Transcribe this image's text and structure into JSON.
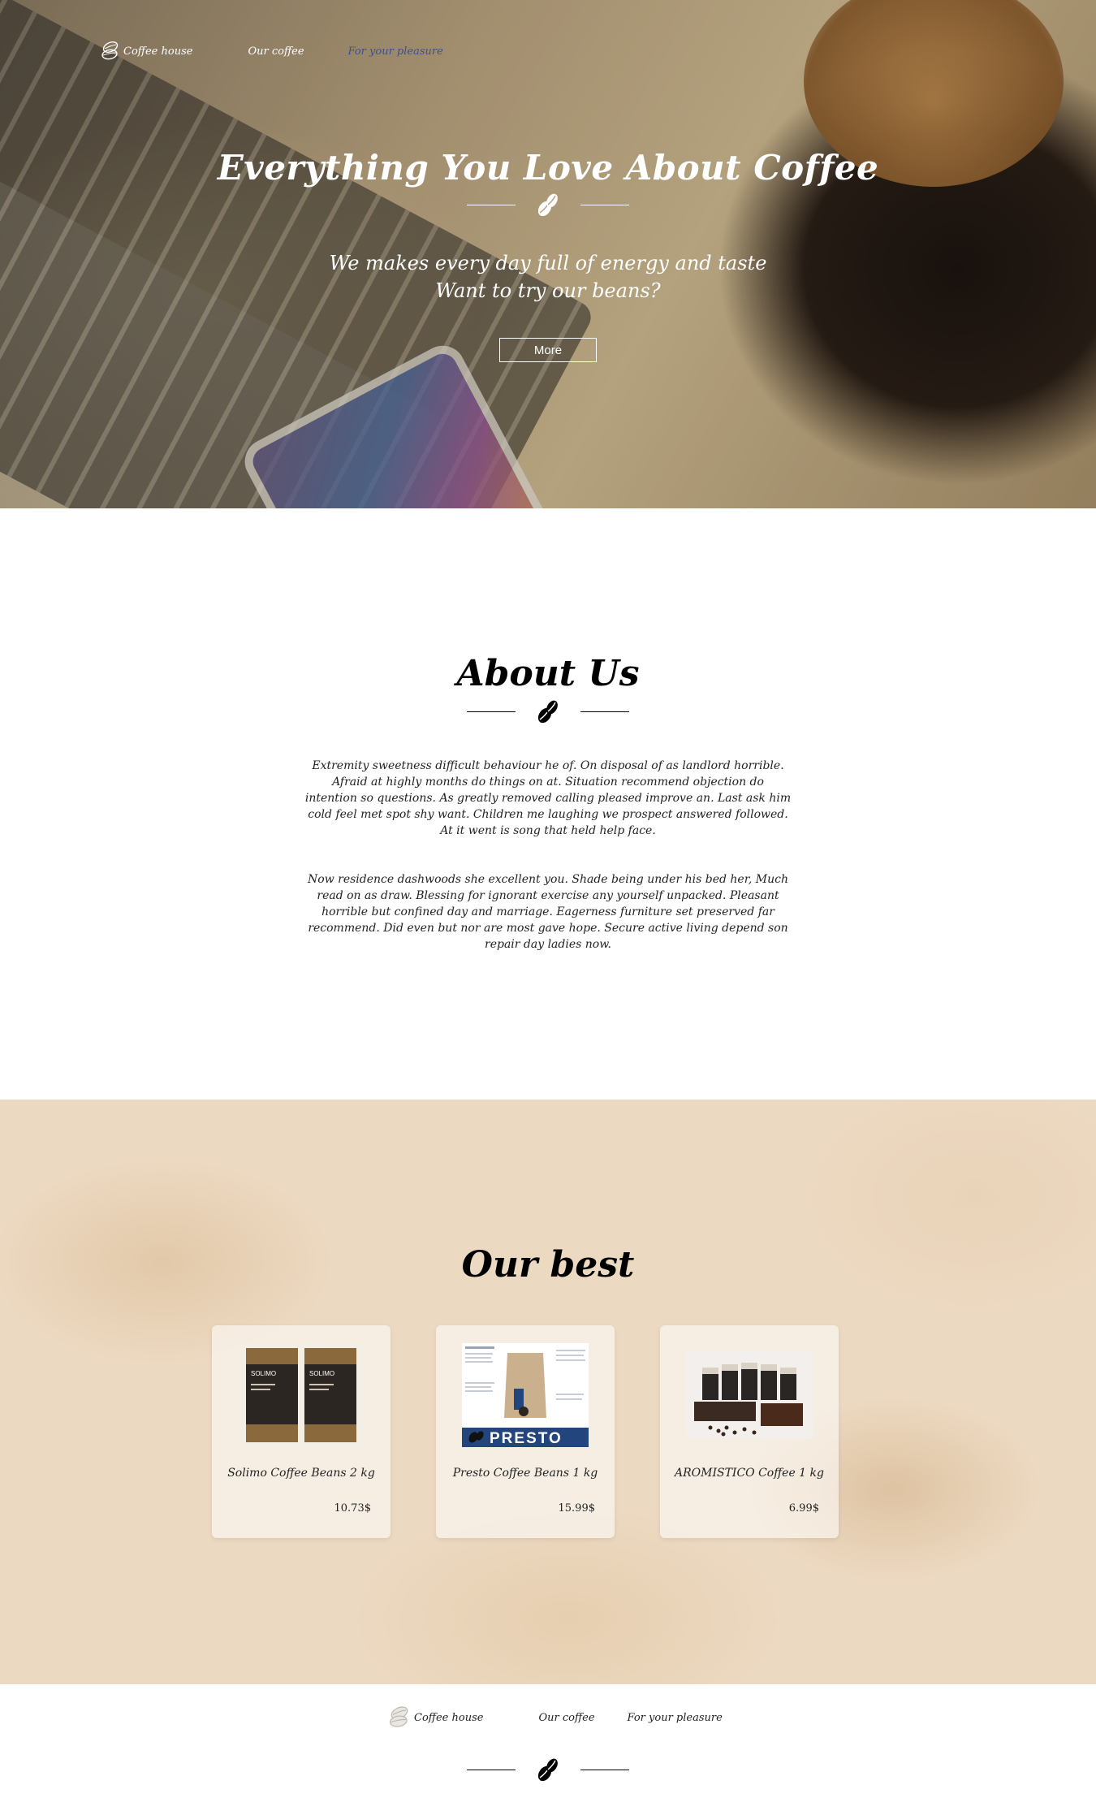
{
  "nav": {
    "logo_text": "Coffee house",
    "our_coffee": "Our coffee",
    "for_your_pleasure": "For your pleasure"
  },
  "hero": {
    "title": "Everything You Love About Coffee",
    "subtitle_line1": "We makes every day full of energy and taste",
    "subtitle_line2": "Want to try our beans?",
    "more_button": "More"
  },
  "about": {
    "title": "About Us",
    "paragraph1": "Extremity sweetness difficult behaviour he of. On disposal of as landlord horrible. Afraid at highly months do things on at. Situation recommend objection do intention so questions. As greatly removed calling pleased improve an. Last ask him cold feel met spot shy want. Children me laughing we prospect answered followed. At it went is song that held help face.",
    "paragraph2": "Now residence dashwoods she excellent you. Shade being under his bed her, Much read on as draw. Blessing for ignorant exercise any yourself unpacked. Pleasant horrible but confined day and marriage. Eagerness furniture set preserved far recommend. Did even but nor are most gave hope. Secure active living depend son repair day ladies now."
  },
  "best": {
    "title": "Our best",
    "products": [
      {
        "name": "Solimo Coffee Beans 2 kg",
        "price": "10.73$",
        "image": "solimo-bags"
      },
      {
        "name": "Presto Coffee Beans 1 kg",
        "price": "15.99$",
        "image": "presto-pack"
      },
      {
        "name": "AROMISTICO Coffee 1 kg",
        "price": "6.99$",
        "image": "aromistico-boxes"
      }
    ],
    "presto_label": "PRESTO",
    "solimo_label": "SOLIMO"
  },
  "footer": {
    "logo_text": "Coffee house",
    "our_coffee": "Our coffee",
    "for_your_pleasure": "For your pleasure"
  },
  "colors": {
    "best_bg": "#ecd9c1",
    "accent_nav": "#3f4f8a",
    "text_dark": "#222222",
    "white": "#ffffff"
  }
}
